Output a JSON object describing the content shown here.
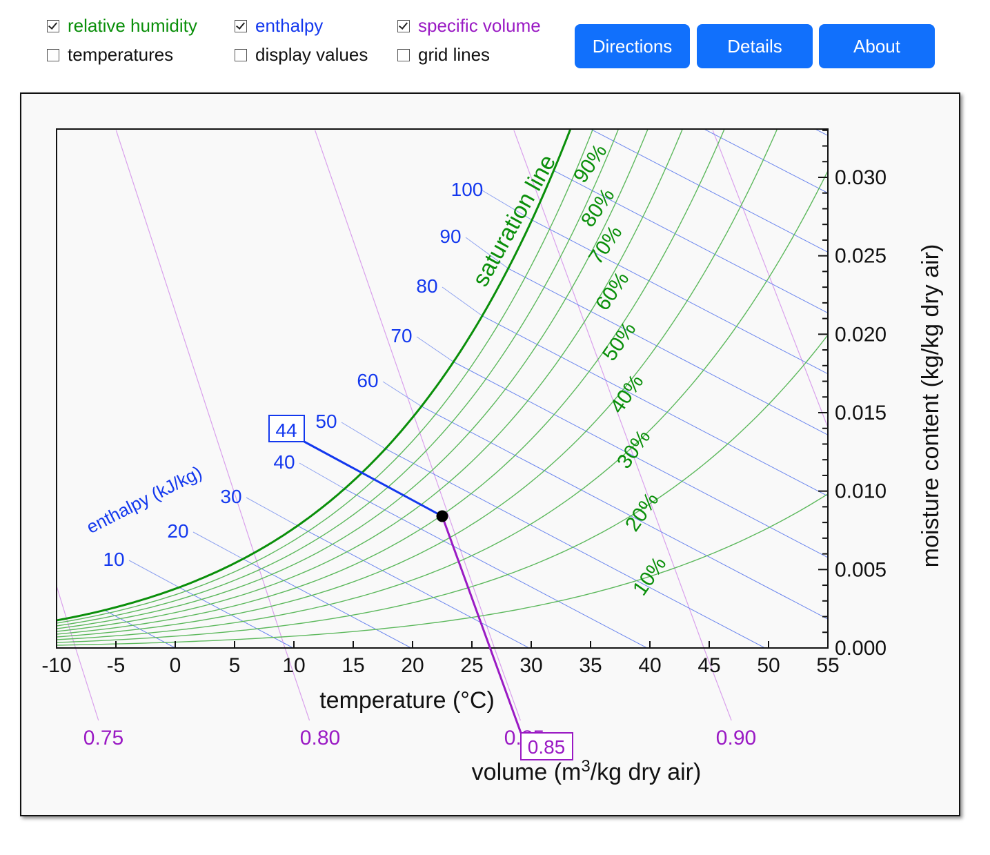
{
  "controls": {
    "checkboxes": [
      {
        "label": "relative humidity",
        "checked": true,
        "color": "#0a8f0a"
      },
      {
        "label": "enthalpy",
        "checked": true,
        "color": "#1338ee"
      },
      {
        "label": "specific volume",
        "checked": true,
        "color": "#9a1ac4"
      },
      {
        "label": "temperatures",
        "checked": false,
        "color": "#111111"
      },
      {
        "label": "display values",
        "checked": false,
        "color": "#111111"
      },
      {
        "label": "grid lines",
        "checked": false,
        "color": "#111111"
      }
    ],
    "buttons": [
      {
        "label": "Directions"
      },
      {
        "label": "Details"
      },
      {
        "label": "About"
      }
    ],
    "button_color": "#1170fc"
  },
  "chart_data": {
    "type": "psychrometric",
    "xlabel": "temperature (°C)",
    "ylabel": "moisture content (kg/kg dry air)",
    "volume_label_prefix": "volume (m",
    "volume_label_sup": "3",
    "volume_label_suffix": "/kg dry air)",
    "enthalpy_axis_label": "enthalpy (kJ/kg)",
    "saturation_label": "saturation line",
    "xlim": [
      -10,
      55
    ],
    "ylim": [
      0,
      0.033
    ],
    "x_ticks": [
      -10,
      -5,
      0,
      5,
      10,
      15,
      20,
      25,
      30,
      35,
      40,
      45,
      50,
      55
    ],
    "x_tick_labels": [
      "-10",
      "-5",
      "0",
      "5",
      "10",
      "15",
      "20",
      "25",
      "30",
      "35",
      "40",
      "45",
      "50",
      "55"
    ],
    "y_ticks": [
      0,
      0.005,
      0.01,
      0.015,
      0.02,
      0.025,
      0.03
    ],
    "y_tick_labels": [
      "0.000",
      "0.005",
      "0.010",
      "0.015",
      "0.020",
      "0.025",
      "0.030"
    ],
    "rh_lines": [
      10,
      20,
      30,
      40,
      50,
      60,
      70,
      80,
      90,
      100
    ],
    "rh_labels": [
      "10%",
      "20%",
      "30%",
      "40%",
      "50%",
      "60%",
      "70%",
      "80%",
      "90%"
    ],
    "enthalpy_lines": [
      0,
      10,
      20,
      30,
      40,
      50,
      60,
      70,
      80,
      90,
      100,
      110,
      120,
      130,
      140,
      150,
      160
    ],
    "enthalpy_labels": [
      "10",
      "20",
      "30",
      "40",
      "50",
      "60",
      "70",
      "80",
      "90",
      "100"
    ],
    "volume_lines": [
      0.75,
      0.8,
      0.85,
      0.9,
      0.95
    ],
    "volume_labels": [
      "0.75",
      "0.80",
      "0.85",
      "0.90"
    ],
    "selected_point": {
      "temperature": 22.5,
      "moisture": 0.0084,
      "enthalpy": 44,
      "volume": 0.85
    },
    "selected_enthalpy_label": "44",
    "selected_volume_label": "0.85",
    "colors": {
      "rh": "#0a8f0a",
      "enthalpy": "#1338ee",
      "volume": "#9a1ac4",
      "point": "#000000"
    }
  }
}
